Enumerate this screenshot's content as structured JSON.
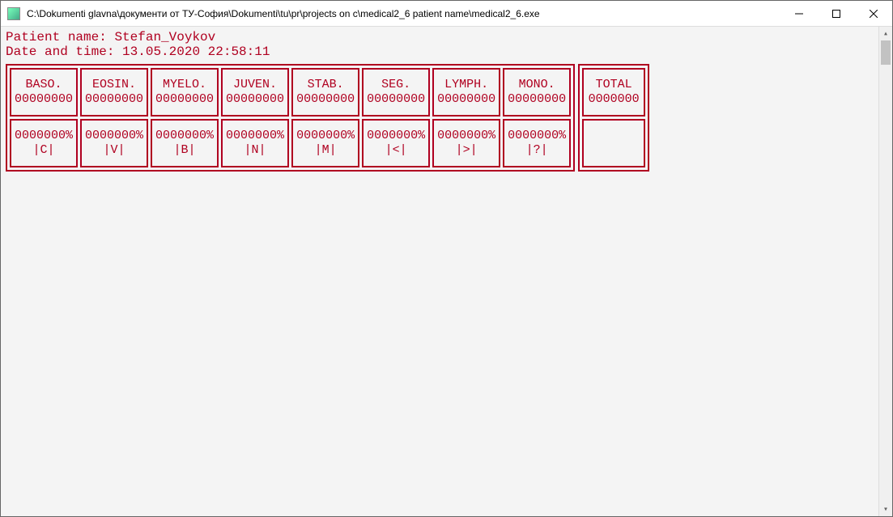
{
  "window": {
    "title": "C:\\Dokumenti glavna\\документи от ТУ-София\\Dokumenti\\tu\\pr\\projects on c\\medical2_6 patient name\\medical2_6.exe"
  },
  "header": {
    "patient_label": "Patient name:",
    "patient_name": "Stefan_Voykov",
    "datetime_label": "Date and time:",
    "datetime_value": "13.05.2020 22:58:11"
  },
  "cells": [
    {
      "label": "BASO.",
      "count": "00000000",
      "pct": "0000000%",
      "key": "|C|"
    },
    {
      "label": "EOSIN.",
      "count": "00000000",
      "pct": "0000000%",
      "key": "|V|"
    },
    {
      "label": "MYELO.",
      "count": "00000000",
      "pct": "0000000%",
      "key": "|B|"
    },
    {
      "label": "JUVEN.",
      "count": "00000000",
      "pct": "0000000%",
      "key": "|N|"
    },
    {
      "label": "STAB.",
      "count": "00000000",
      "pct": "0000000%",
      "key": "|M|"
    },
    {
      "label": "SEG.",
      "count": "00000000",
      "pct": "0000000%",
      "key": "|<|"
    },
    {
      "label": "LYMPH.",
      "count": "00000000",
      "pct": "0000000%",
      "key": "|>|"
    },
    {
      "label": "MONO.",
      "count": "00000000",
      "pct": "0000000%",
      "key": "|?|"
    }
  ],
  "total": {
    "label": "TOTAL",
    "count": "0000000"
  }
}
